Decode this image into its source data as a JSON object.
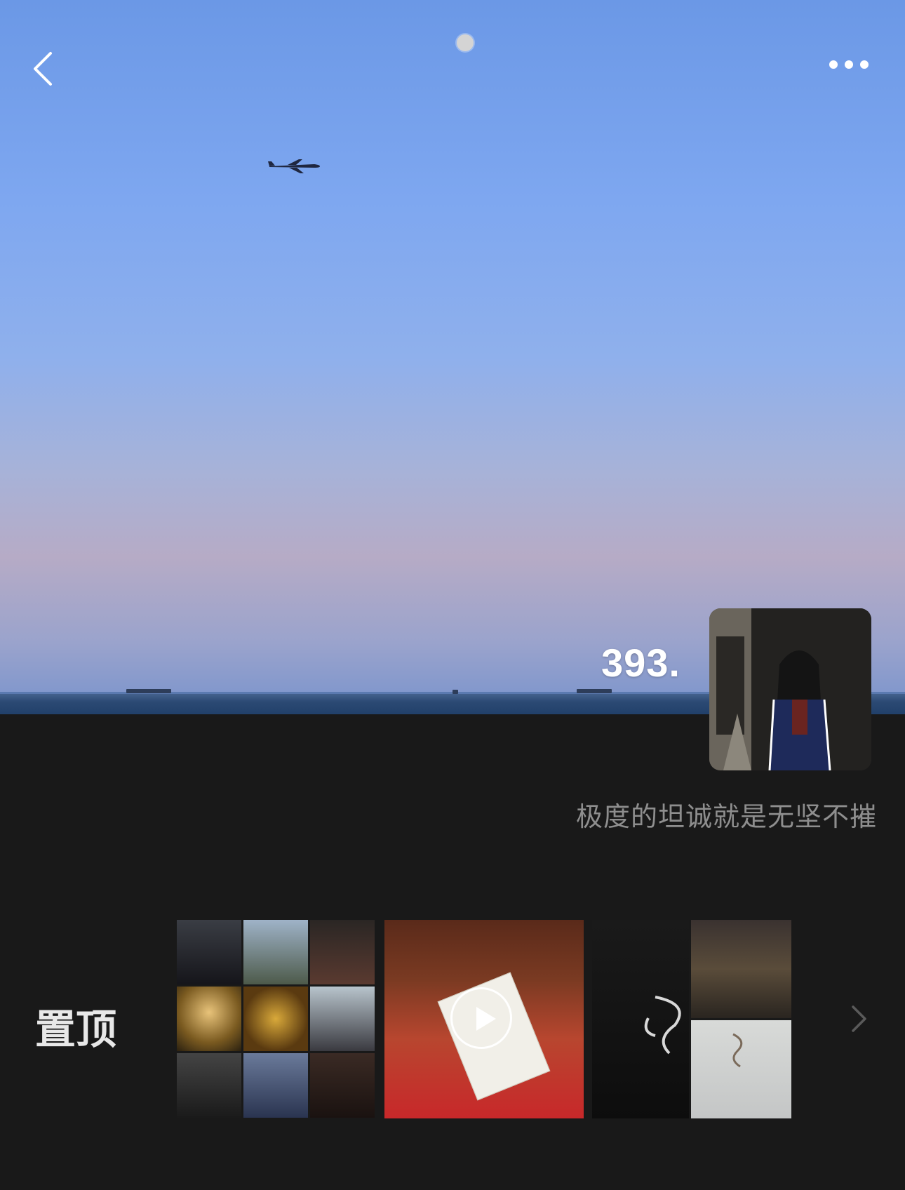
{
  "profile": {
    "username": "393.",
    "bio": "极度的坦诚就是无坚不摧"
  },
  "pinned": {
    "label": "置顶"
  },
  "icons": {
    "back": "chevron-left-icon",
    "more": "ellipsis-icon",
    "play": "play-icon",
    "next": "chevron-right-icon"
  }
}
